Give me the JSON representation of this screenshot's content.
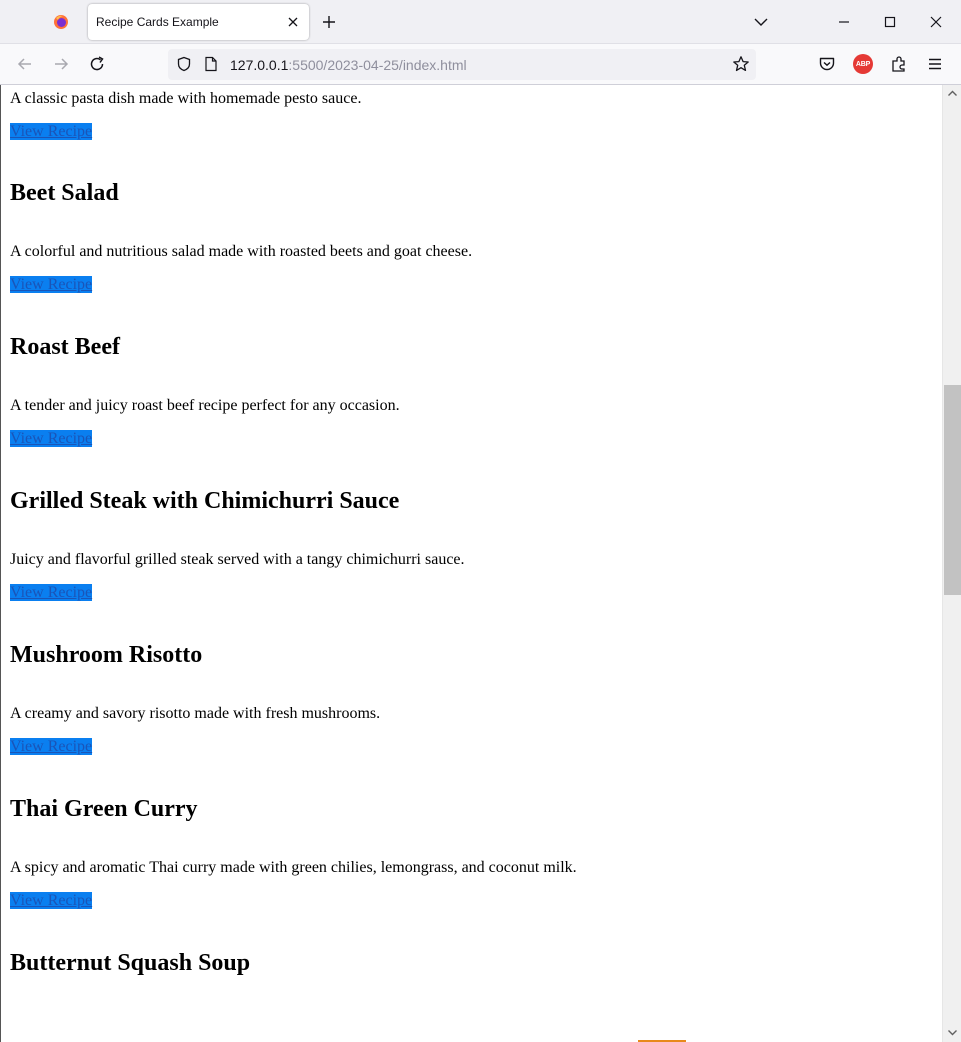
{
  "browser": {
    "tab_title": "Recipe Cards Example",
    "url_host": "127.0.0.1",
    "url_rest": ":5500/2023-04-25/index.html",
    "abp_label": "ABP"
  },
  "first_card": {
    "description": "A classic pasta dish made with homemade pesto sauce.",
    "link_label": "View Recipe"
  },
  "recipes": [
    {
      "title": "Beet Salad",
      "description": "A colorful and nutritious salad made with roasted beets and goat cheese.",
      "link_label": "View Recipe"
    },
    {
      "title": "Roast Beef",
      "description": "A tender and juicy roast beef recipe perfect for any occasion.",
      "link_label": "View Recipe"
    },
    {
      "title": "Grilled Steak with Chimichurri Sauce",
      "description": "Juicy and flavorful grilled steak served with a tangy chimichurri sauce.",
      "link_label": "View Recipe"
    },
    {
      "title": "Mushroom Risotto",
      "description": "A creamy and savory risotto made with fresh mushrooms.",
      "link_label": "View Recipe"
    },
    {
      "title": "Thai Green Curry",
      "description": "A spicy and aromatic Thai curry made with green chilies, lemongrass, and coconut milk.",
      "link_label": "View Recipe"
    },
    {
      "title": "Butternut Squash Soup"
    }
  ],
  "colors": {
    "link_background": "#0a7ff0",
    "link_text": "#1a55b8"
  }
}
